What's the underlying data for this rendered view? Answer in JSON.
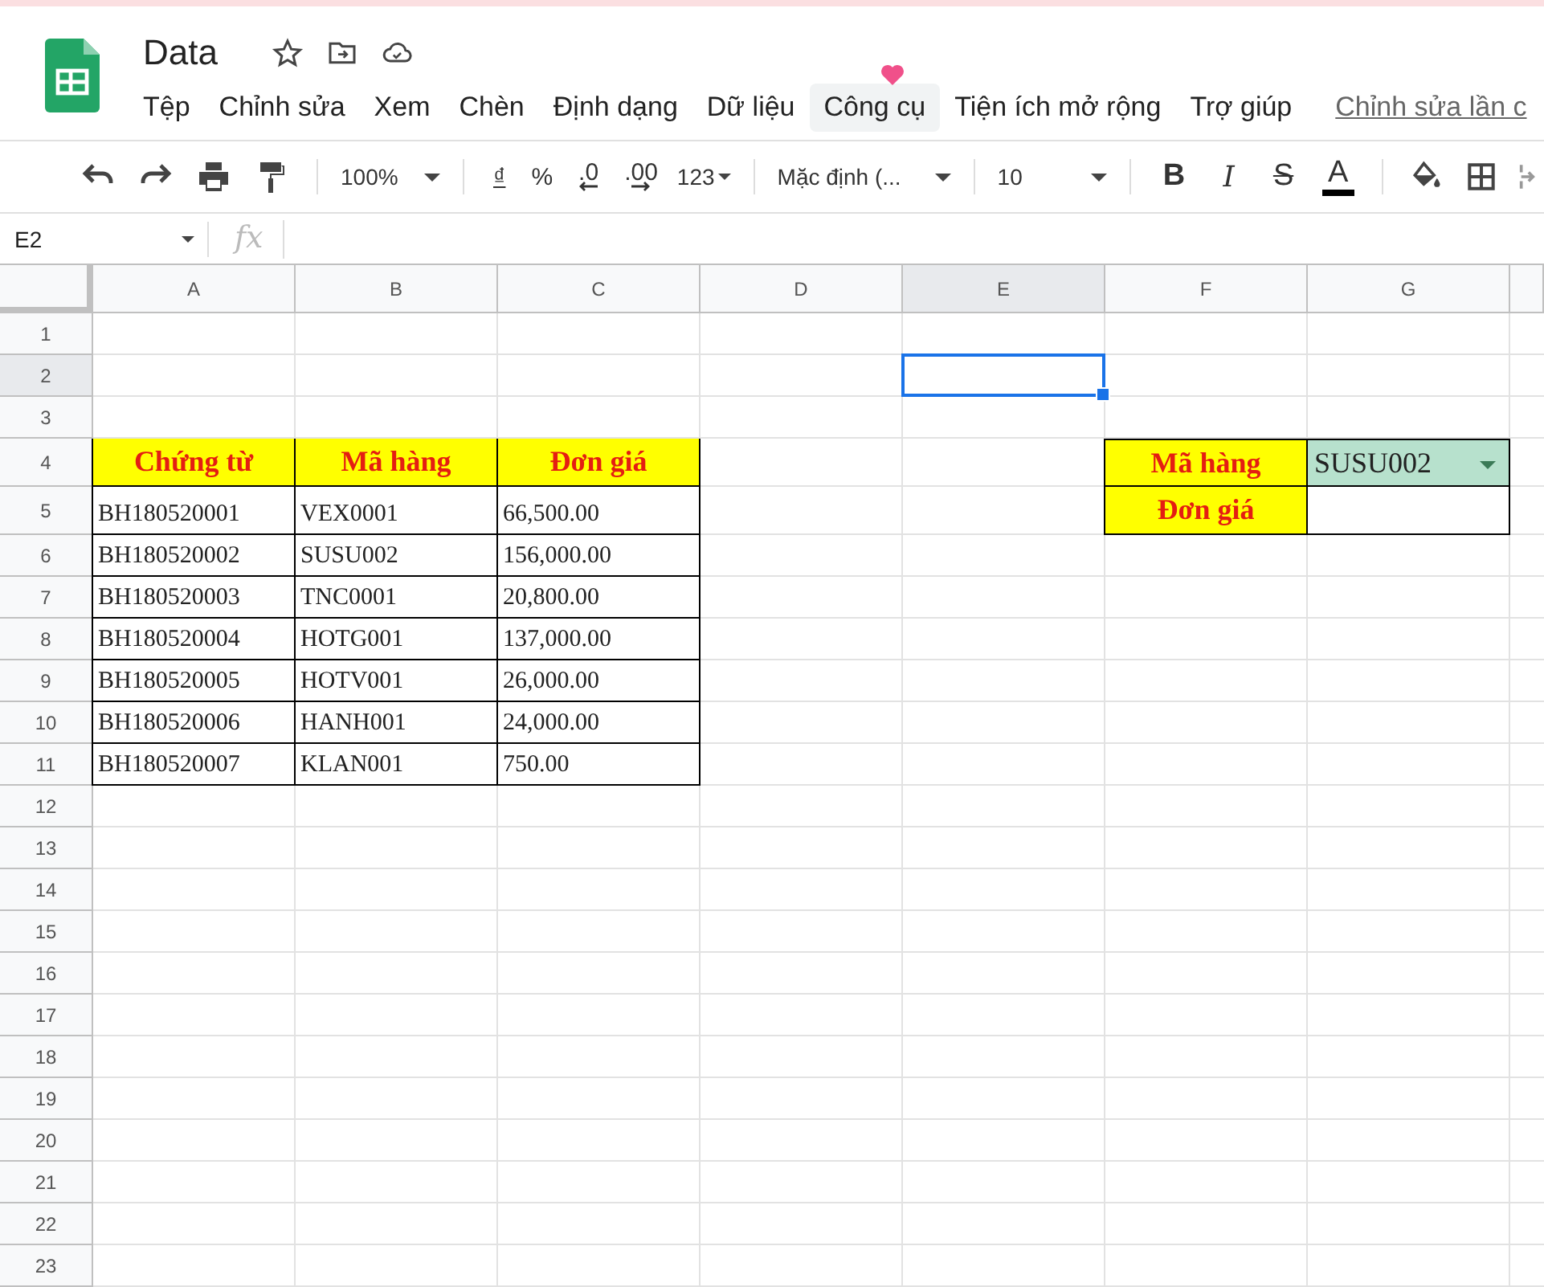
{
  "document": {
    "title": "Data"
  },
  "menu": [
    {
      "label": "Tệp",
      "selected": false
    },
    {
      "label": "Chỉnh sửa",
      "selected": false
    },
    {
      "label": "Xem",
      "selected": false
    },
    {
      "label": "Chèn",
      "selected": false
    },
    {
      "label": "Định dạng",
      "selected": false
    },
    {
      "label": "Dữ liệu",
      "selected": false
    },
    {
      "label": "Công cụ",
      "selected": true
    },
    {
      "label": "Tiện ích mở rộng",
      "selected": false
    },
    {
      "label": "Trợ giúp",
      "selected": false
    }
  ],
  "last_edit_link": "Chỉnh sửa lần c",
  "toolbar": {
    "zoom": "100%",
    "currency": "₫",
    "percent": "%",
    "decrease_decimals": ".0",
    "increase_decimals": ".00",
    "number_format": "123",
    "font": "Mặc định (...",
    "font_size": "10",
    "bold": "B",
    "italic": "I",
    "strikethrough": "S",
    "text_color": "A"
  },
  "formula_bar": {
    "name_box": "E2",
    "fx": "fx"
  },
  "columns": [
    {
      "label": "A",
      "selected": false
    },
    {
      "label": "B",
      "selected": false
    },
    {
      "label": "C",
      "selected": false
    },
    {
      "label": "D",
      "selected": false
    },
    {
      "label": "E",
      "selected": true
    },
    {
      "label": "F",
      "selected": false
    },
    {
      "label": "G",
      "selected": false
    }
  ],
  "rows": [
    {
      "label": "1",
      "selected": false
    },
    {
      "label": "2",
      "selected": true
    },
    {
      "label": "3",
      "selected": false
    },
    {
      "label": "4",
      "selected": false
    },
    {
      "label": "5",
      "selected": false
    },
    {
      "label": "6",
      "selected": false
    },
    {
      "label": "7",
      "selected": false
    },
    {
      "label": "8",
      "selected": false
    },
    {
      "label": "9",
      "selected": false
    },
    {
      "label": "10",
      "selected": false
    },
    {
      "label": "11",
      "selected": false
    },
    {
      "label": "12",
      "selected": false
    },
    {
      "label": "13",
      "selected": false
    },
    {
      "label": "14",
      "selected": false
    },
    {
      "label": "15",
      "selected": false
    },
    {
      "label": "16",
      "selected": false
    },
    {
      "label": "17",
      "selected": false
    },
    {
      "label": "18",
      "selected": false
    },
    {
      "label": "19",
      "selected": false
    },
    {
      "label": "20",
      "selected": false
    },
    {
      "label": "21",
      "selected": false
    },
    {
      "label": "22",
      "selected": false
    },
    {
      "label": "23",
      "selected": false
    }
  ],
  "main_table": {
    "headers": [
      "Chứng từ",
      "Mã hàng",
      "Đơn giá"
    ],
    "rows": [
      [
        "BH180520001",
        "VEX0001",
        "66,500.00"
      ],
      [
        "BH180520002",
        "SUSU002",
        "156,000.00"
      ],
      [
        "BH180520003",
        "TNC0001",
        "20,800.00"
      ],
      [
        "BH180520004",
        "HOTG001",
        "137,000.00"
      ],
      [
        "BH180520005",
        "HOTV001",
        "26,000.00"
      ],
      [
        "BH180520006",
        "HANH001",
        "24,000.00"
      ],
      [
        "BH180520007",
        "KLAN001",
        "750.00"
      ]
    ]
  },
  "lookup_table": [
    {
      "label": "Mã hàng",
      "kind": "dropdown",
      "value": "SUSU002"
    },
    {
      "label": "Đơn giá",
      "kind": "empty"
    }
  ]
}
